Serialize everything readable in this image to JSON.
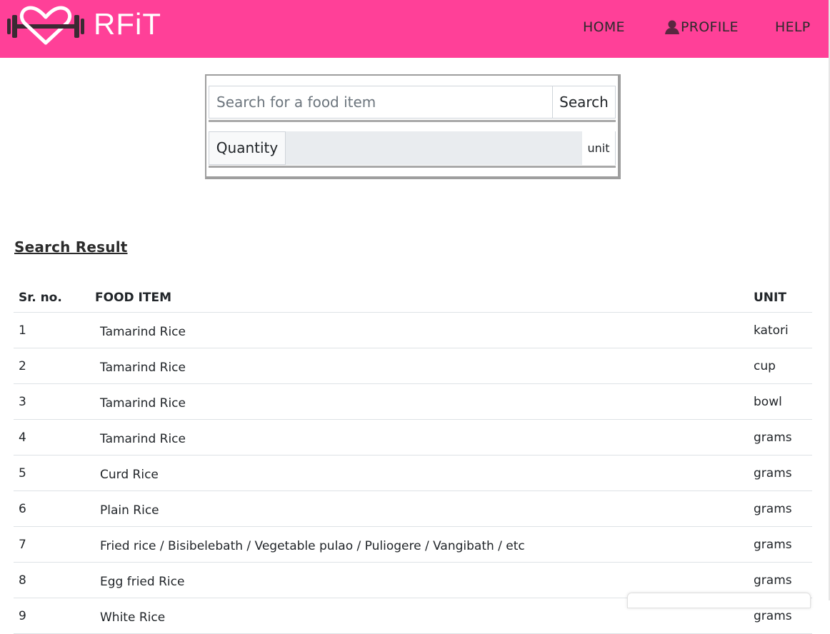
{
  "brand": {
    "name": "RFiT",
    "logo_icon": "heart-dumbbell-icon"
  },
  "nav": {
    "home": "HOME",
    "profile": "PROFILE",
    "help": "HELP",
    "profile_icon": "person-icon"
  },
  "search": {
    "placeholder": "Search for a food item",
    "value": "",
    "button": "Search",
    "quantity_label": "Quantity",
    "quantity_value": "",
    "unit_label": "unit"
  },
  "results": {
    "title": "Search Result",
    "headers": {
      "sr": "Sr. no.",
      "item": "FOOD ITEM",
      "unit": "UNIT"
    },
    "rows": [
      {
        "sr": "1",
        "item": "Tamarind Rice",
        "unit": "katori"
      },
      {
        "sr": "2",
        "item": "Tamarind Rice",
        "unit": "cup"
      },
      {
        "sr": "3",
        "item": "Tamarind Rice",
        "unit": "bowl"
      },
      {
        "sr": "4",
        "item": "Tamarind Rice",
        "unit": "grams"
      },
      {
        "sr": "5",
        "item": "Curd Rice",
        "unit": "grams"
      },
      {
        "sr": "6",
        "item": "Plain Rice",
        "unit": "grams"
      },
      {
        "sr": "7",
        "item": "Fried rice / Bisibelebath / Vegetable pulao / Puliogere / Vangibath / etc",
        "unit": "grams"
      },
      {
        "sr": "8",
        "item": "Egg fried Rice",
        "unit": "grams"
      },
      {
        "sr": "9",
        "item": "White Rice",
        "unit": "grams"
      }
    ]
  },
  "colors": {
    "navbar": "#ff4098",
    "nav_text": "#2b2b2b",
    "brand_text": "#ffffff",
    "logo_dumbbell": "#3a2a33"
  }
}
